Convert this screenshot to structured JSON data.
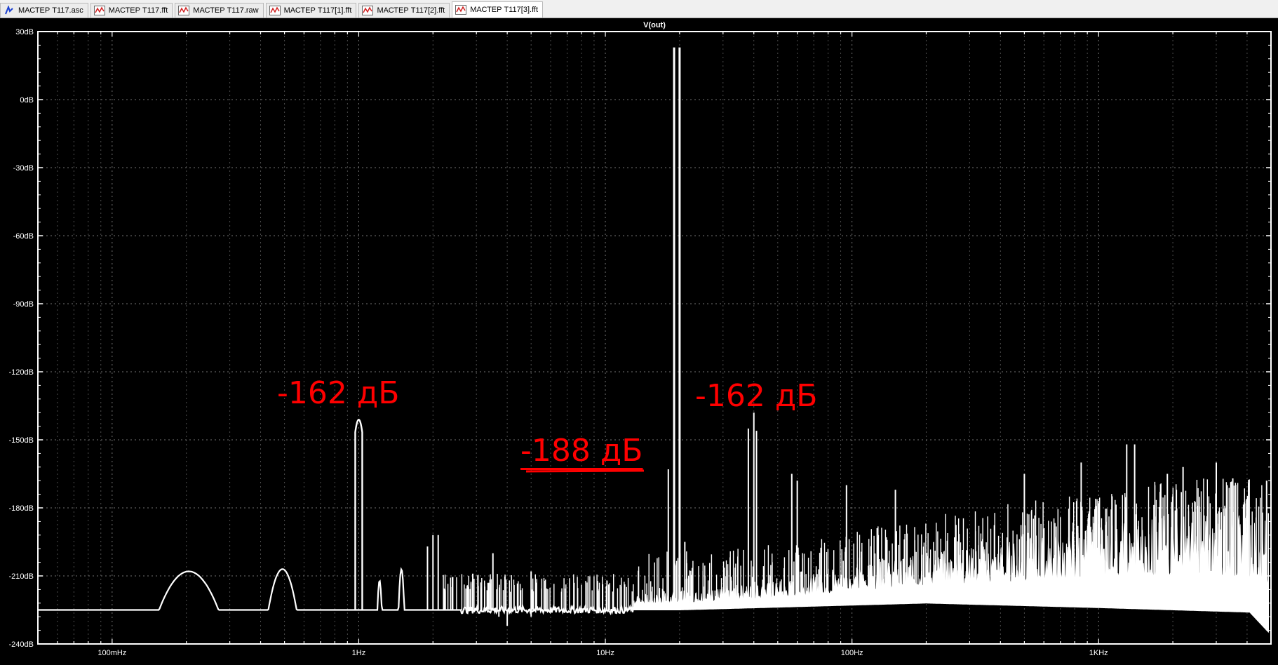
{
  "tabs": [
    {
      "label": "МАСТЕР Т117.asc",
      "icon": "schematic-icon",
      "active": false
    },
    {
      "label": "МАСТЕР Т117.fft",
      "icon": "waveform-icon",
      "active": false
    },
    {
      "label": "МАСТЕР Т117.raw",
      "icon": "waveform-icon",
      "active": false
    },
    {
      "label": "МАСТЕР Т117[1].fft",
      "icon": "waveform-icon",
      "active": false
    },
    {
      "label": "МАСТЕР Т117[2].fft",
      "icon": "waveform-icon",
      "active": false
    },
    {
      "label": "МАСТЕР Т117[3].fft",
      "icon": "waveform-icon",
      "active": true
    }
  ],
  "colors": {
    "background": "#000000",
    "trace": "#ffffff",
    "grid": "#808080",
    "annotation": "#ff0000"
  },
  "chart_data": {
    "type": "line",
    "title": "V(out)",
    "xscale": "log",
    "xlim": [
      0.05,
      5000
    ],
    "ylim": [
      -240,
      30
    ],
    "xticks": [
      {
        "value": 0.1,
        "label": "100mHz"
      },
      {
        "value": 1,
        "label": "1Hz"
      },
      {
        "value": 10,
        "label": "10Hz"
      },
      {
        "value": 100,
        "label": "100Hz"
      },
      {
        "value": 1000,
        "label": "1KHz"
      }
    ],
    "yticks": [
      {
        "value": 30,
        "label": "30dB"
      },
      {
        "value": 0,
        "label": "0dB"
      },
      {
        "value": -30,
        "label": "-30dB"
      },
      {
        "value": -60,
        "label": "-60dB"
      },
      {
        "value": -90,
        "label": "-90dB"
      },
      {
        "value": -120,
        "label": "-120dB"
      },
      {
        "value": -150,
        "label": "-150dB"
      },
      {
        "value": -180,
        "label": "-180dB"
      },
      {
        "value": -210,
        "label": "-210dB"
      },
      {
        "value": -240,
        "label": "-240dB"
      }
    ],
    "grid": true,
    "series": [
      {
        "name": "V(out)",
        "noise_floor": [
          [
            0.05,
            -225
          ],
          [
            5,
            -225
          ],
          [
            20,
            -225
          ],
          [
            200,
            -222
          ],
          [
            1000,
            -224
          ],
          [
            4100,
            -226
          ],
          [
            5000,
            -236
          ]
        ],
        "noise_top": [
          [
            15,
            -218
          ],
          [
            50,
            -212
          ],
          [
            200,
            -200
          ],
          [
            1000,
            -188
          ],
          [
            2000,
            -182
          ],
          [
            5000,
            -183
          ]
        ],
        "humps": [
          {
            "f_start": 0.155,
            "f_end": 0.27,
            "peak": -208
          },
          {
            "f_start": 0.43,
            "f_end": 0.56,
            "peak": -207
          },
          {
            "f_start": 1.19,
            "f_end": 1.24,
            "peak": -212
          },
          {
            "f_start": 1.45,
            "f_end": 1.53,
            "peak": -207
          }
        ],
        "peaks": [
          {
            "f": 1.0,
            "db": -138
          },
          {
            "f": 1.9,
            "db": -197
          },
          {
            "f": 2.0,
            "db": -192
          },
          {
            "f": 2.1,
            "db": -192
          },
          {
            "f": 2.9,
            "db": -209
          },
          {
            "f": 3.5,
            "db": -200
          },
          {
            "f": 5,
            "db": -208
          },
          {
            "f": 18,
            "db": -163
          },
          {
            "f": 19,
            "db": 23
          },
          {
            "f": 20,
            "db": 23
          },
          {
            "f": 21,
            "db": -195
          },
          {
            "f": 38,
            "db": -145
          },
          {
            "f": 40,
            "db": -138
          },
          {
            "f": 41,
            "db": -146
          },
          {
            "f": 57,
            "db": -165
          },
          {
            "f": 60,
            "db": -168
          },
          {
            "f": 95,
            "db": -170
          },
          {
            "f": 150,
            "db": -172
          },
          {
            "f": 500,
            "db": -165
          },
          {
            "f": 850,
            "db": -160
          },
          {
            "f": 1300,
            "db": -152
          },
          {
            "f": 1400,
            "db": -152
          },
          {
            "f": 1900,
            "db": -165
          },
          {
            "f": 2200,
            "db": -162
          },
          {
            "f": 3000,
            "db": -160
          },
          {
            "f": 3500,
            "db": -167
          },
          {
            "f": 4800,
            "db": -168
          }
        ]
      }
    ]
  },
  "annotations": [
    {
      "text": "-162 дБ",
      "underlined": false
    },
    {
      "text": "-188 дБ",
      "underlined": true
    },
    {
      "text": "-162 дБ",
      "underlined": false
    }
  ]
}
